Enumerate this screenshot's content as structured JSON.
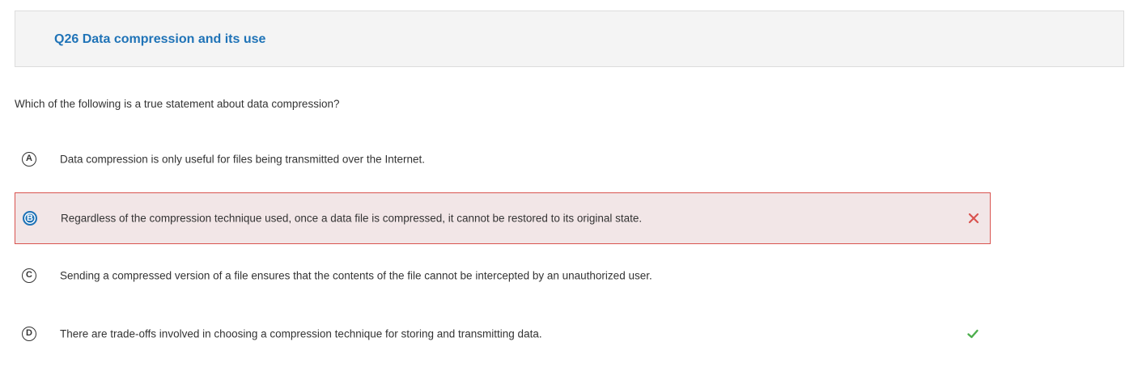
{
  "header": {
    "title": "Q26 Data compression and its use"
  },
  "question": {
    "text": "Which of the following is a true statement about data compression?"
  },
  "options": [
    {
      "letter": "A",
      "text": "Data compression is only useful for files being transmitted over the Internet.",
      "selected": false,
      "status": "none"
    },
    {
      "letter": "B",
      "text": "Regardless of the compression technique used, once a data file is compressed, it cannot be restored to its original state.",
      "selected": true,
      "status": "incorrect",
      "status_icon": "close-icon",
      "status_color": "#d9534f"
    },
    {
      "letter": "C",
      "text": "Sending a compressed version of a file ensures that the contents of the file cannot be intercepted by an unauthorized user.",
      "selected": false,
      "status": "none"
    },
    {
      "letter": "D",
      "text": "There are trade-offs involved in choosing a compression technique for storing and transmitting data.",
      "selected": false,
      "status": "correct",
      "status_icon": "checkmark-icon",
      "status_color": "#4cae4c"
    }
  ],
  "colors": {
    "accent": "#1f73b7",
    "header_bg": "#f4f4f4",
    "wrong_bg": "#f2e6e7",
    "wrong_border": "#d9534f",
    "correct": "#4cae4c"
  }
}
